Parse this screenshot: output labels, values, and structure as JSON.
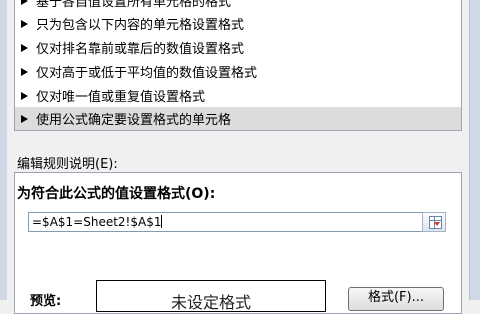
{
  "rule_types": [
    {
      "label": "基于各自值设置所有单元格的格式",
      "selected": false
    },
    {
      "label": "只为包含以下内容的单元格设置格式",
      "selected": false
    },
    {
      "label": "仅对排名靠前或靠后的数值设置格式",
      "selected": false
    },
    {
      "label": "仅对高于或低于平均值的数值设置格式",
      "selected": false
    },
    {
      "label": "仅对唯一值或重复值设置格式",
      "selected": false
    },
    {
      "label": "使用公式确定要设置格式的单元格",
      "selected": true
    }
  ],
  "rule_description_label": "编辑规则说明(E):",
  "formula_label": "为符合此公式的值设置格式(O):",
  "formula_value": "=$A$1=Sheet2!$A$1",
  "preview_label": "预览:",
  "preview_text": "未设定格式",
  "format_button": "格式(F)...",
  "collapse_icon": "range-select-icon"
}
